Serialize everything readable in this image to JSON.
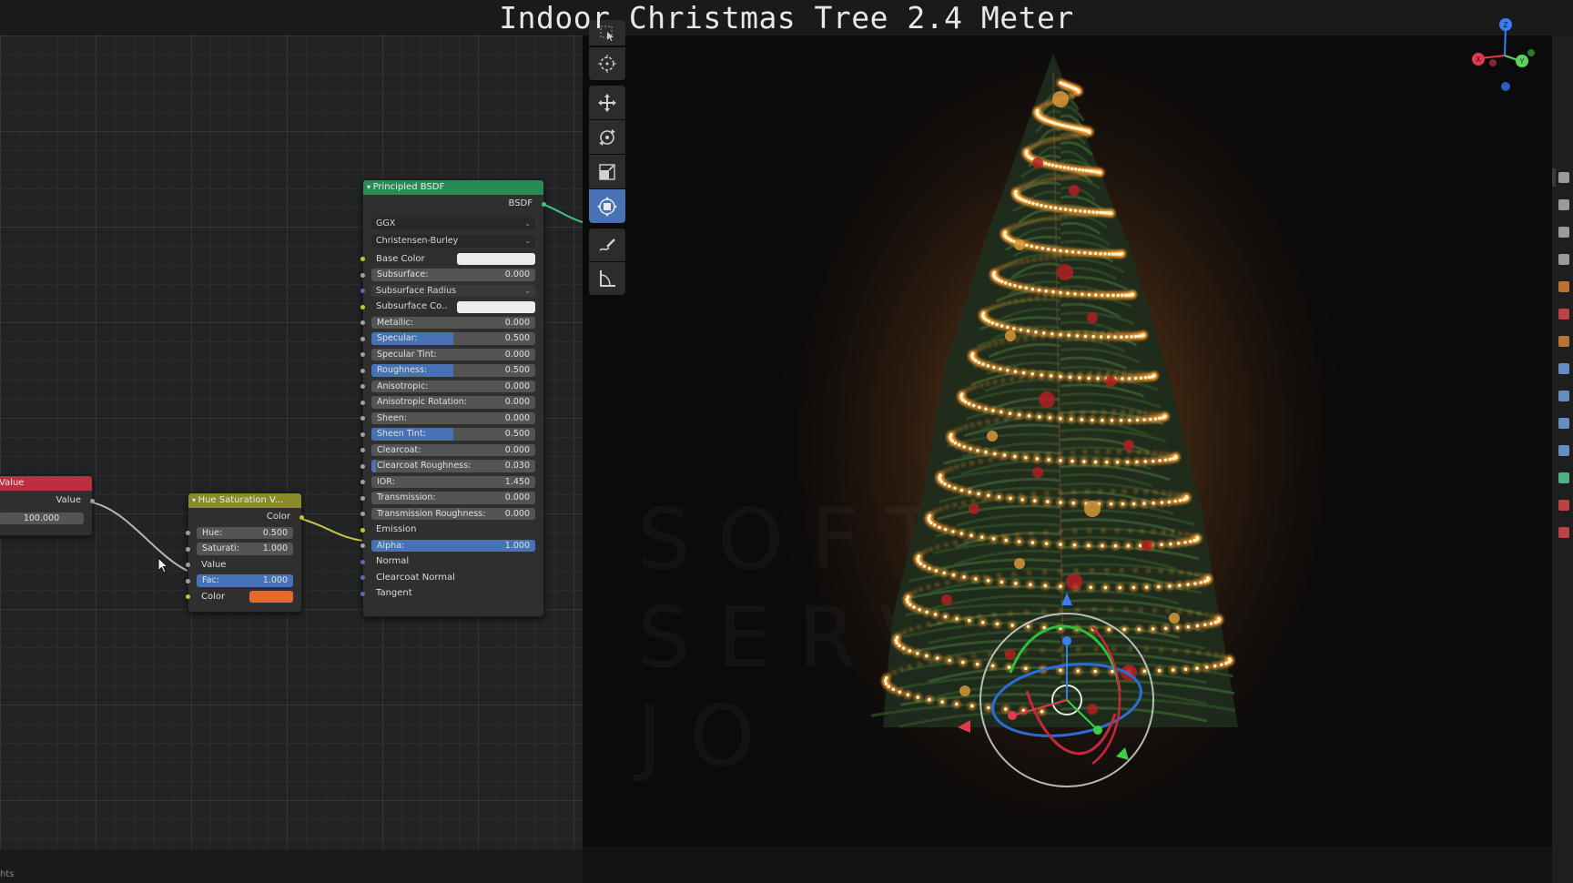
{
  "video_title": "Indoor Christmas Tree 2.4 Meter",
  "footer_text": "hts",
  "nodes": {
    "value": {
      "title": "Value",
      "output_label": "Value",
      "value": "100.000"
    },
    "hue_saturation": {
      "title": "Hue Saturation V...",
      "output_label": "Color",
      "hue_label": "Hue:",
      "hue_value": "0.500",
      "saturation_label": "Saturati:",
      "saturation_value": "1.000",
      "value_label": "Value",
      "fac_label": "Fac:",
      "fac_value": "1.000",
      "color_label": "Color",
      "color_swatch": "#e6692a"
    },
    "principled": {
      "title": "Principled BSDF",
      "output_label": "BSDF",
      "distribution": "GGX",
      "subsurface_method": "Christensen-Burley",
      "base_color_label": "Base Color",
      "subsurface_radius_label": "Subsurface Radius",
      "subsurface_color_label": "Subsurface Co..",
      "emission_label": "Emission",
      "normal_label": "Normal",
      "clearcoat_normal_label": "Clearcoat Normal",
      "tangent_label": "Tangent",
      "subsurface": {
        "label": "Subsurface:",
        "value": "0.000",
        "fill": 0.0
      },
      "metallic": {
        "label": "Metallic:",
        "value": "0.000",
        "fill": 0.0
      },
      "specular": {
        "label": "Specular:",
        "value": "0.500",
        "fill": 0.5
      },
      "specular_tint": {
        "label": "Specular Tint:",
        "value": "0.000",
        "fill": 0.0
      },
      "roughness": {
        "label": "Roughness:",
        "value": "0.500",
        "fill": 0.5
      },
      "anisotropic": {
        "label": "Anisotropic:",
        "value": "0.000",
        "fill": 0.0
      },
      "anisotropic_rotation": {
        "label": "Anisotropic Rotation:",
        "value": "0.000",
        "fill": 0.0
      },
      "sheen": {
        "label": "Sheen:",
        "value": "0.000",
        "fill": 0.0
      },
      "sheen_tint": {
        "label": "Sheen Tint:",
        "value": "0.500",
        "fill": 0.5
      },
      "clearcoat": {
        "label": "Clearcoat:",
        "value": "0.000",
        "fill": 0.0
      },
      "clearcoat_roughness": {
        "label": "Clearcoat Roughness:",
        "value": "0.030",
        "fill": 0.03
      },
      "ior": {
        "label": "IOR:",
        "value": "1.450",
        "fill": 0.0
      },
      "transmission": {
        "label": "Transmission:",
        "value": "0.000",
        "fill": 0.0
      },
      "transmission_roughness": {
        "label": "Transmission Roughness:",
        "value": "0.000",
        "fill": 0.0
      },
      "alpha": {
        "label": "Alpha:",
        "value": "1.000",
        "fill": 1.0
      }
    }
  },
  "viewport": {
    "watermark_lines": [
      "SOFTW",
      "SERV",
      "JO"
    ],
    "gizmo_axes": [
      "X",
      "Y",
      "Z"
    ]
  },
  "colors": {
    "value_header": "#b83042",
    "hue_header": "#8a8a2b",
    "principled_header": "#2a8a55",
    "active_tool": "#4772b3",
    "light_glow": "#ffb347"
  },
  "toolbar_icons": [
    "select-box-icon",
    "cursor-icon",
    "move-icon",
    "rotate-icon",
    "scale-icon",
    "transform-icon",
    "annotate-icon",
    "measure-icon"
  ]
}
